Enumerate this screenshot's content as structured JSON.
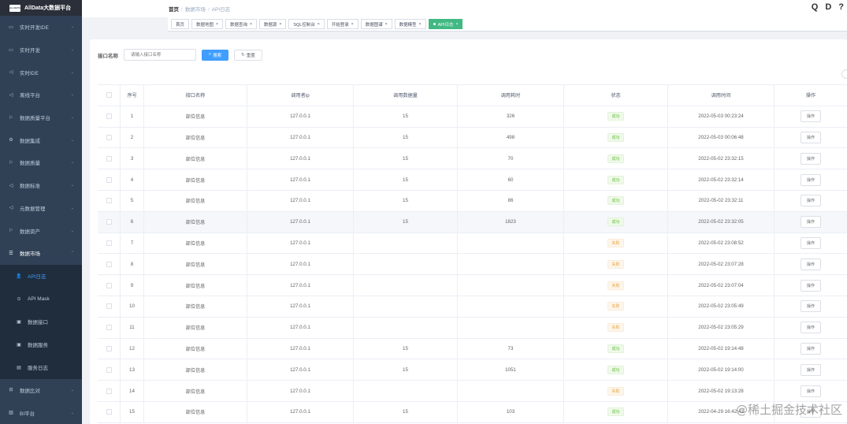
{
  "app": {
    "logo_small": "ALLDATA",
    "title": "AllData大数据平台"
  },
  "sidebar": {
    "items": [
      {
        "icon": "▭",
        "label": "实时开发IDE"
      },
      {
        "icon": "▭",
        "label": "实时开发"
      },
      {
        "icon": "◁",
        "label": "实时IDE"
      },
      {
        "icon": "◁",
        "label": "离线平台"
      },
      {
        "icon": "⚐",
        "label": "数据质量平台"
      },
      {
        "icon": "⚙",
        "label": "数据集成"
      },
      {
        "icon": "⚐",
        "label": "数据质量"
      },
      {
        "icon": "◁",
        "label": "数据标准"
      },
      {
        "icon": "◁",
        "label": "元数据管理"
      },
      {
        "icon": "⚐",
        "label": "数据资产"
      }
    ],
    "open_group": {
      "icon": "☰",
      "label": "数据市场"
    },
    "sub_items": [
      {
        "icon": "👤",
        "label": "API日志",
        "active": true
      },
      {
        "icon": "⊙",
        "label": "API Mask"
      },
      {
        "icon": "▣",
        "label": "数据接口"
      },
      {
        "icon": "▣",
        "label": "数据服务"
      },
      {
        "icon": "▤",
        "label": "服务日志"
      }
    ],
    "bottom_items": [
      {
        "icon": "⊟",
        "label": "数据比对"
      },
      {
        "icon": "▥",
        "label": "BI平台"
      }
    ]
  },
  "breadcrumb": [
    "首页",
    "数据市场",
    "API日志"
  ],
  "nav_icons": [
    "Q",
    "D",
    "?"
  ],
  "tags": [
    {
      "label": "首页",
      "closable": false
    },
    {
      "label": "数据地图",
      "closable": true
    },
    {
      "label": "数据查询",
      "closable": true
    },
    {
      "label": "数据源",
      "closable": true
    },
    {
      "label": "SQL控制台",
      "closable": true
    },
    {
      "label": "开始登录",
      "closable": true
    },
    {
      "label": "数据图谱",
      "closable": true
    },
    {
      "label": "数据模型",
      "closable": true
    },
    {
      "label": "API日志",
      "closable": true,
      "active": true
    }
  ],
  "search": {
    "label": "接口名称",
    "placeholder": "请输入接口名称",
    "search_btn": "搜索",
    "reset_btn": "重置"
  },
  "table": {
    "headers": [
      "序号",
      "接口名称",
      "调用者ip",
      "调用数据量",
      "调用耗时",
      "状态",
      "调用时间",
      "操作"
    ],
    "rows": [
      {
        "no": "1",
        "name": "部位信息",
        "ip": "127.0.0.1",
        "count": "15",
        "time": "326",
        "status": "成功",
        "status_type": "ok",
        "date": "2022-05-03 00:23:24",
        "op": "操作"
      },
      {
        "no": "2",
        "name": "部位信息",
        "ip": "127.0.0.1",
        "count": "15",
        "time": "498",
        "status": "成功",
        "status_type": "ok",
        "date": "2022-05-03 00:06:48",
        "op": "操作"
      },
      {
        "no": "3",
        "name": "部位信息",
        "ip": "127.0.0.1",
        "count": "15",
        "time": "70",
        "status": "成功",
        "status_type": "ok",
        "date": "2022-05-02 23:32:15",
        "op": "操作"
      },
      {
        "no": "4",
        "name": "部位信息",
        "ip": "127.0.0.1",
        "count": "15",
        "time": "60",
        "status": "成功",
        "status_type": "ok",
        "date": "2022-05-02 23:32:14",
        "op": "操作"
      },
      {
        "no": "5",
        "name": "部位信息",
        "ip": "127.0.0.1",
        "count": "15",
        "time": "86",
        "status": "成功",
        "status_type": "ok",
        "date": "2022-05-02 23:32:11",
        "op": "操作"
      },
      {
        "no": "6",
        "name": "部位信息",
        "ip": "127.0.0.1",
        "count": "15",
        "time": "1823",
        "status": "成功",
        "status_type": "ok",
        "date": "2022-05-02 23:32:05",
        "op": "操作",
        "highlight": true
      },
      {
        "no": "7",
        "name": "部位信息",
        "ip": "127.0.0.1",
        "count": "",
        "time": "",
        "status": "失败",
        "status_type": "fail",
        "date": "2022-05-02 23:08:52",
        "op": "操作"
      },
      {
        "no": "8",
        "name": "部位信息",
        "ip": "127.0.0.1",
        "count": "",
        "time": "",
        "status": "失败",
        "status_type": "fail",
        "date": "2022-05-02 23:07:28",
        "op": "操作"
      },
      {
        "no": "9",
        "name": "部位信息",
        "ip": "127.0.0.1",
        "count": "",
        "time": "",
        "status": "失败",
        "status_type": "fail",
        "date": "2022-05-02 23:07:04",
        "op": "操作"
      },
      {
        "no": "10",
        "name": "部位信息",
        "ip": "127.0.0.1",
        "count": "",
        "time": "",
        "status": "失败",
        "status_type": "fail",
        "date": "2022-05-02 23:05:49",
        "op": "操作"
      },
      {
        "no": "11",
        "name": "部位信息",
        "ip": "127.0.0.1",
        "count": "",
        "time": "",
        "status": "失败",
        "status_type": "fail",
        "date": "2022-05-02 23:05:29",
        "op": "操作"
      },
      {
        "no": "12",
        "name": "部位信息",
        "ip": "127.0.0.1",
        "count": "15",
        "time": "73",
        "status": "成功",
        "status_type": "ok",
        "date": "2022-05-02 19:14:48",
        "op": "操作"
      },
      {
        "no": "13",
        "name": "部位信息",
        "ip": "127.0.0.1",
        "count": "15",
        "time": "1051",
        "status": "成功",
        "status_type": "ok",
        "date": "2022-05-02 19:14:00",
        "op": "操作"
      },
      {
        "no": "14",
        "name": "部位信息",
        "ip": "127.0.0.1",
        "count": "",
        "time": "",
        "status": "失败",
        "status_type": "fail",
        "date": "2022-05-02 19:13:28",
        "op": "操作"
      },
      {
        "no": "15",
        "name": "部位信息",
        "ip": "127.0.0.1",
        "count": "15",
        "time": "103",
        "status": "成功",
        "status_type": "ok",
        "date": "2022-04-29 16:42:41",
        "op": "操作"
      }
    ]
  },
  "watermark": "@稀土掘金技术社区"
}
